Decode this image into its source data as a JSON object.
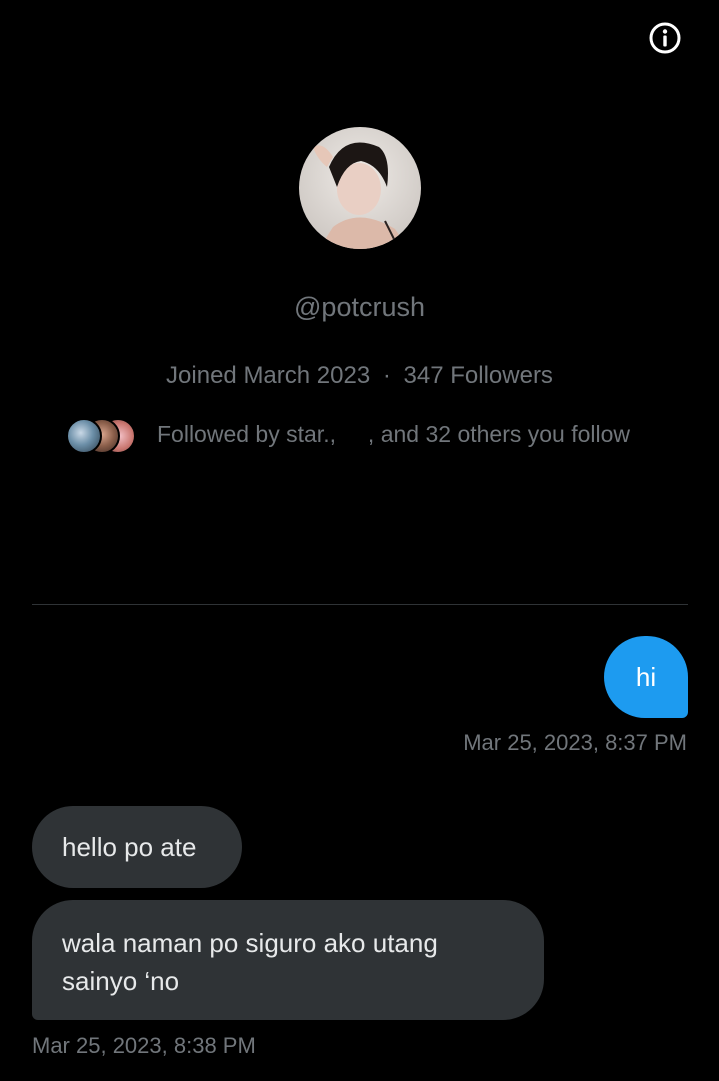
{
  "header": {
    "info_icon": "info-circle-icon"
  },
  "profile": {
    "avatar_icon": "profile-photo",
    "handle": "@potcrush",
    "joined": "Joined March 2023",
    "separator": "·",
    "followers": "347 Followers",
    "followed_by": "Followed by star.,     , and 32 others you follow"
  },
  "messages": [
    {
      "direction": "outgoing",
      "text": "hi",
      "timestamp": "Mar 25, 2023, 8:37 PM"
    },
    {
      "direction": "incoming",
      "text": "hello po ate"
    },
    {
      "direction": "incoming",
      "text": "wala naman po siguro ako utang sainyo ‘no",
      "timestamp": "Mar 25, 2023, 8:38 PM"
    }
  ],
  "colors": {
    "background": "#000000",
    "accent": "#1d9bf0",
    "bubble_in": "#2f3336",
    "muted_text": "#71767b",
    "text": "#e7e9ea"
  }
}
